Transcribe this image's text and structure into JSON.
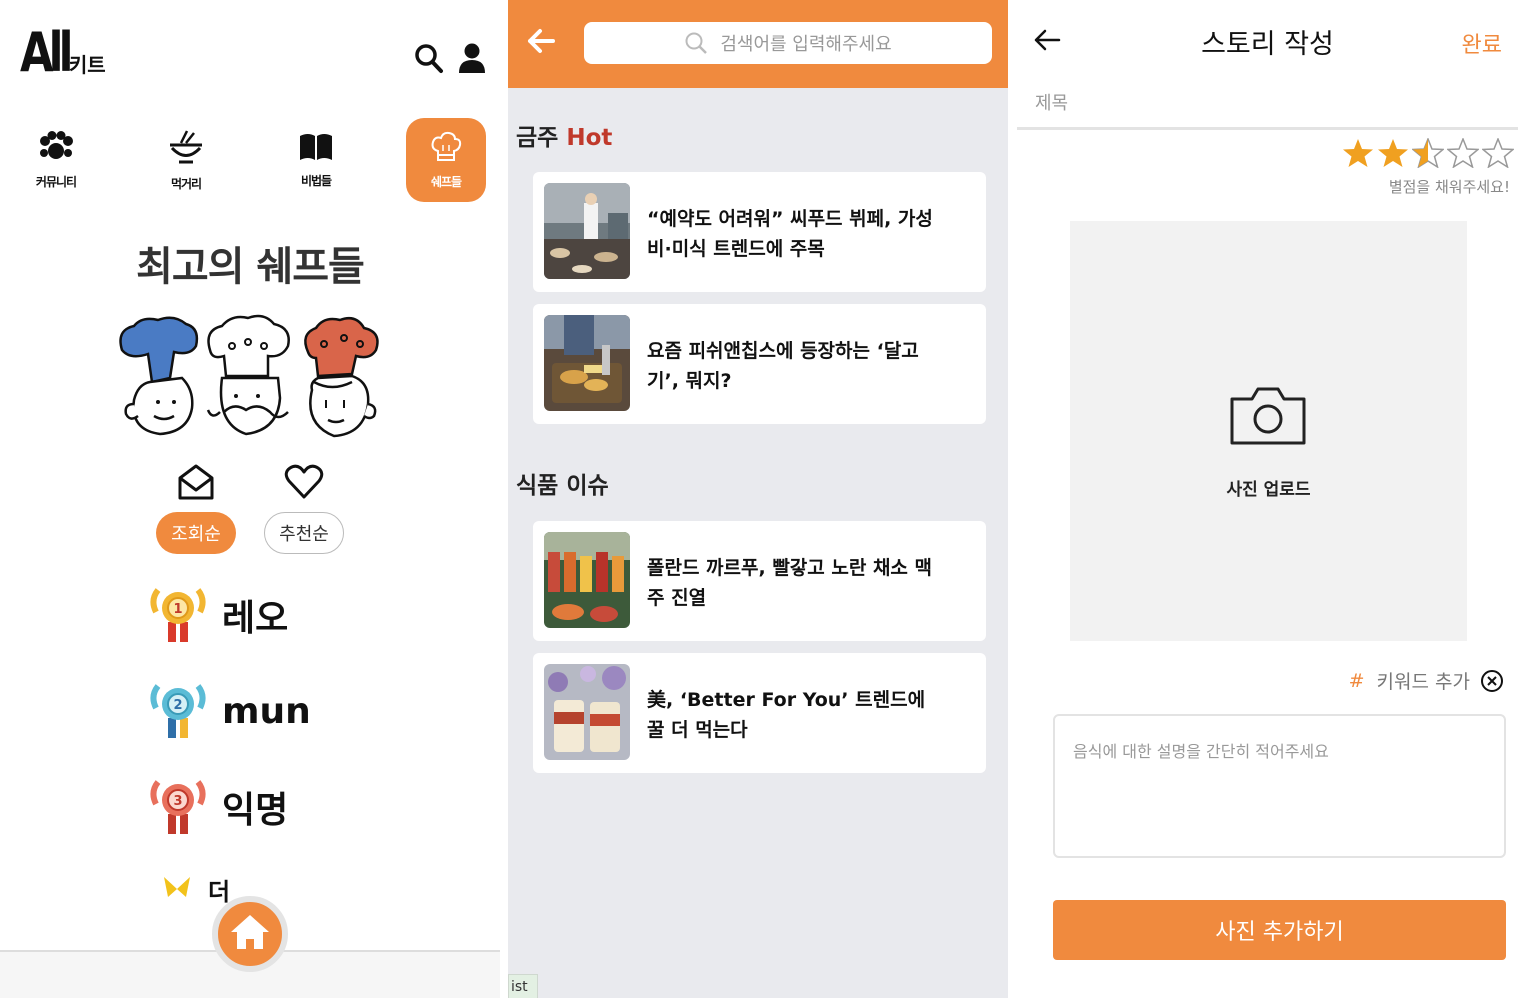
{
  "accent": "#f08a3e",
  "screen1": {
    "logo_main": "All",
    "logo_sub": "키트",
    "icons": [
      "search-icon",
      "user-icon"
    ],
    "categories": [
      {
        "label": "커뮤니티",
        "icon": "paw-icon"
      },
      {
        "label": "먹거리",
        "icon": "bowl-icon"
      },
      {
        "label": "비법들",
        "icon": "book-icon"
      },
      {
        "label": "쉐프들",
        "icon": "chef-hat-icon"
      }
    ],
    "heading": "최고의 쉐프들",
    "sort_options": [
      "조회순",
      "추천순"
    ],
    "ranking": [
      {
        "rank": "1",
        "name": "레오"
      },
      {
        "rank": "2",
        "name": "mun"
      },
      {
        "rank": "3",
        "name": "익명"
      }
    ],
    "more_label": "더"
  },
  "screen2": {
    "search_placeholder": "검색어를 입력해주세요",
    "section_hot_prefix": "금주",
    "section_hot_suffix": "Hot",
    "section_issue": "식품 이슈",
    "hot_articles": [
      {
        "title": "“예약도 어려워” 씨푸드 뷔페, 가성비·미식 트렌드에 주목"
      },
      {
        "title": "요즘 피쉬앤칩스에 등장하는 ‘달고기’, 뭐지?"
      }
    ],
    "issue_articles": [
      {
        "title": "폴란드 까르푸, 빨갛고 노란 채소 맥주 진열"
      },
      {
        "title": "美, ‘Better For You’ 트렌드에 꿀 더 먹는다"
      }
    ],
    "corner_tab": "ist"
  },
  "screen3": {
    "title": "스토리 작성",
    "done_label": "완료",
    "title_placeholder": "제목",
    "rating": 2.5,
    "rating_max": 5,
    "rating_hint": "별점을 채워주세요!",
    "photo_upload_label": "사진 업로드",
    "keyword_hash": "#",
    "keyword_label": "키워드 추가",
    "description_placeholder": "음식에 대한 설명을 간단히 적어주세요",
    "add_photo_button": "사진 추가하기"
  }
}
